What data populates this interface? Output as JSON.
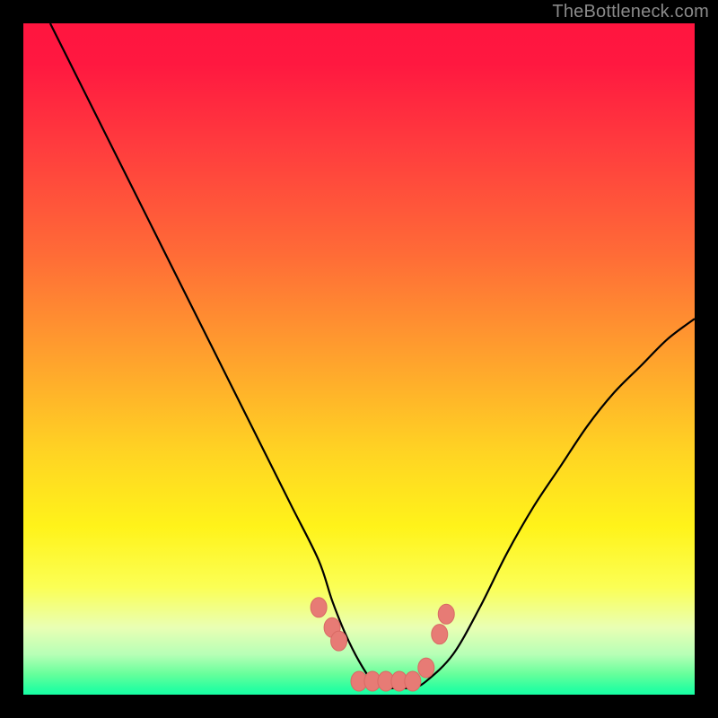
{
  "watermark": {
    "text": "TheBottleneck.com"
  },
  "colors": {
    "curve_stroke": "#000000",
    "marker_fill": "#e77b75",
    "marker_stroke": "#d86a64"
  },
  "chart_data": {
    "type": "line",
    "title": "",
    "xlabel": "",
    "ylabel": "",
    "xlim": [
      0,
      100
    ],
    "ylim": [
      0,
      100
    ],
    "grid": false,
    "series": [
      {
        "name": "bottleneck-curve",
        "x": [
          4,
          8,
          12,
          16,
          20,
          24,
          28,
          32,
          36,
          40,
          44,
          46,
          48,
          50,
          52,
          54,
          56,
          58,
          60,
          64,
          68,
          72,
          76,
          80,
          84,
          88,
          92,
          96,
          100
        ],
        "values": [
          100,
          92,
          84,
          76,
          68,
          60,
          52,
          44,
          36,
          28,
          20,
          14,
          9,
          5,
          2,
          1,
          1,
          1,
          2,
          6,
          13,
          21,
          28,
          34,
          40,
          45,
          49,
          53,
          56
        ]
      }
    ],
    "markers": {
      "name": "highlight-dots",
      "x": [
        44,
        46,
        47,
        50,
        52,
        54,
        56,
        58,
        60,
        62,
        63
      ],
      "values": [
        13,
        10,
        8,
        2,
        2,
        2,
        2,
        2,
        4,
        9,
        12
      ]
    }
  }
}
